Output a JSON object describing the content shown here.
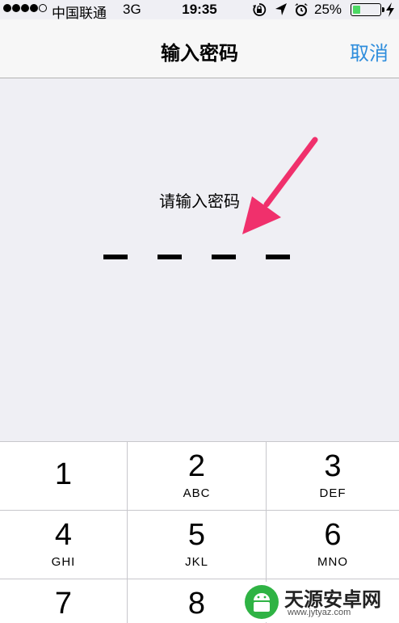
{
  "status_bar": {
    "signal_dots": 5,
    "signal_filled": 4,
    "carrier": "中国联通",
    "network": "3G",
    "time": "19:35",
    "battery_percent": "25%",
    "battery_level": 0.25,
    "icons": [
      "rotation-lock-icon",
      "location-arrow-icon",
      "alarm-clock-icon",
      "battery-icon",
      "charging-bolt-icon"
    ]
  },
  "nav": {
    "title": "输入密码",
    "cancel": "取消",
    "cancel_color": "#2e8ddc"
  },
  "passcode": {
    "prompt": "请输入密码",
    "digits": 4
  },
  "annotation": {
    "arrow_color": "#f0306c"
  },
  "keypad": {
    "keys": [
      {
        "num": "1",
        "letters": ""
      },
      {
        "num": "2",
        "letters": "ABC"
      },
      {
        "num": "3",
        "letters": "DEF"
      },
      {
        "num": "4",
        "letters": "GHI"
      },
      {
        "num": "5",
        "letters": "JKL"
      },
      {
        "num": "6",
        "letters": "MNO"
      },
      {
        "num": "7",
        "letters": ""
      },
      {
        "num": "8",
        "letters": ""
      }
    ]
  },
  "watermark": {
    "name": "天源安卓网",
    "url": "www.jytyaz.com"
  }
}
